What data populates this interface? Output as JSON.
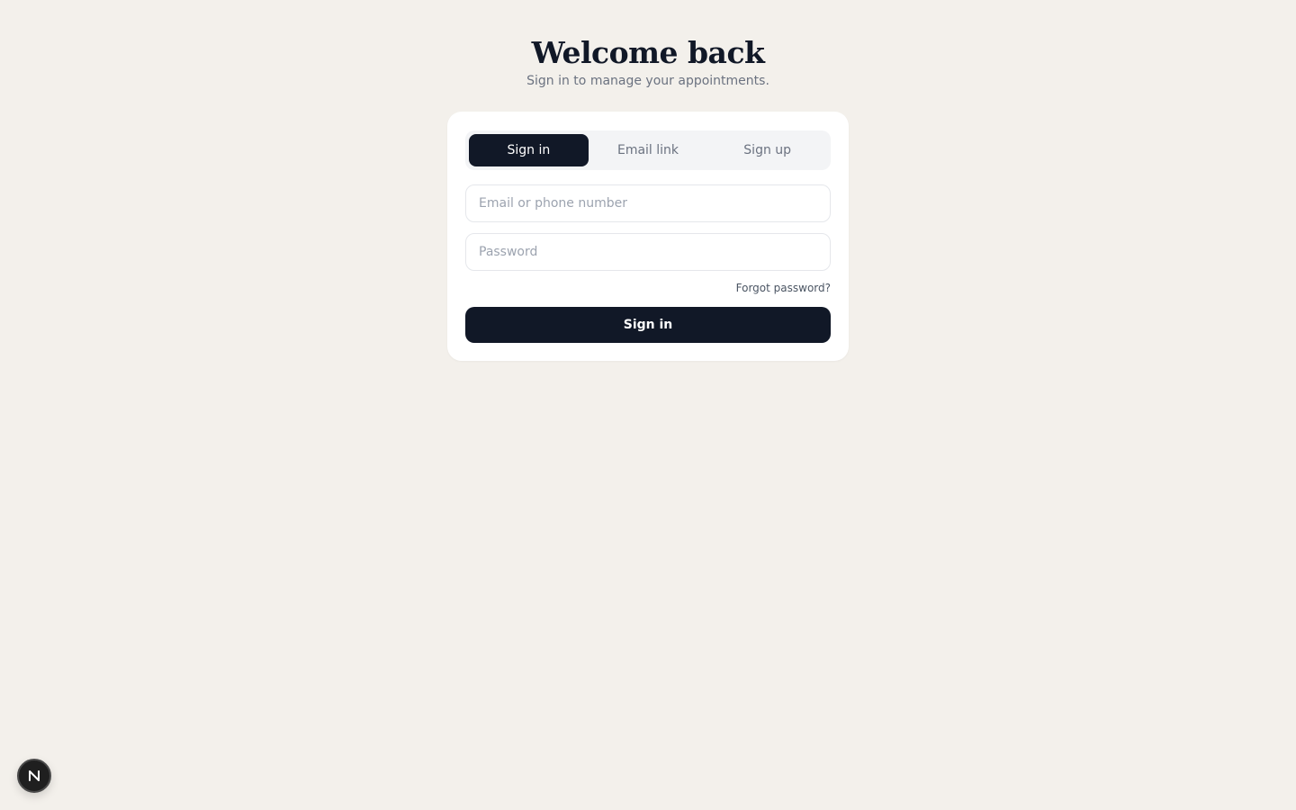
{
  "header": {
    "title": "Welcome back",
    "subtitle": "Sign in to manage your appointments."
  },
  "auth_tabs": [
    {
      "label": "Sign in",
      "active": true
    },
    {
      "label": "Email link",
      "active": false
    },
    {
      "label": "Sign up",
      "active": false
    }
  ],
  "form": {
    "email_placeholder": "Email or phone number",
    "email_value": "",
    "password_placeholder": "Password",
    "password_value": "",
    "forgot_label": "Forgot password?",
    "submit_label": "Sign in"
  },
  "dev_badge": {
    "icon": "nextjs-logo-icon",
    "letter": "N"
  },
  "colors": {
    "background": "#f3f0eb",
    "primary": "#111827",
    "card": "#ffffff",
    "muted_text": "#6b7280"
  }
}
